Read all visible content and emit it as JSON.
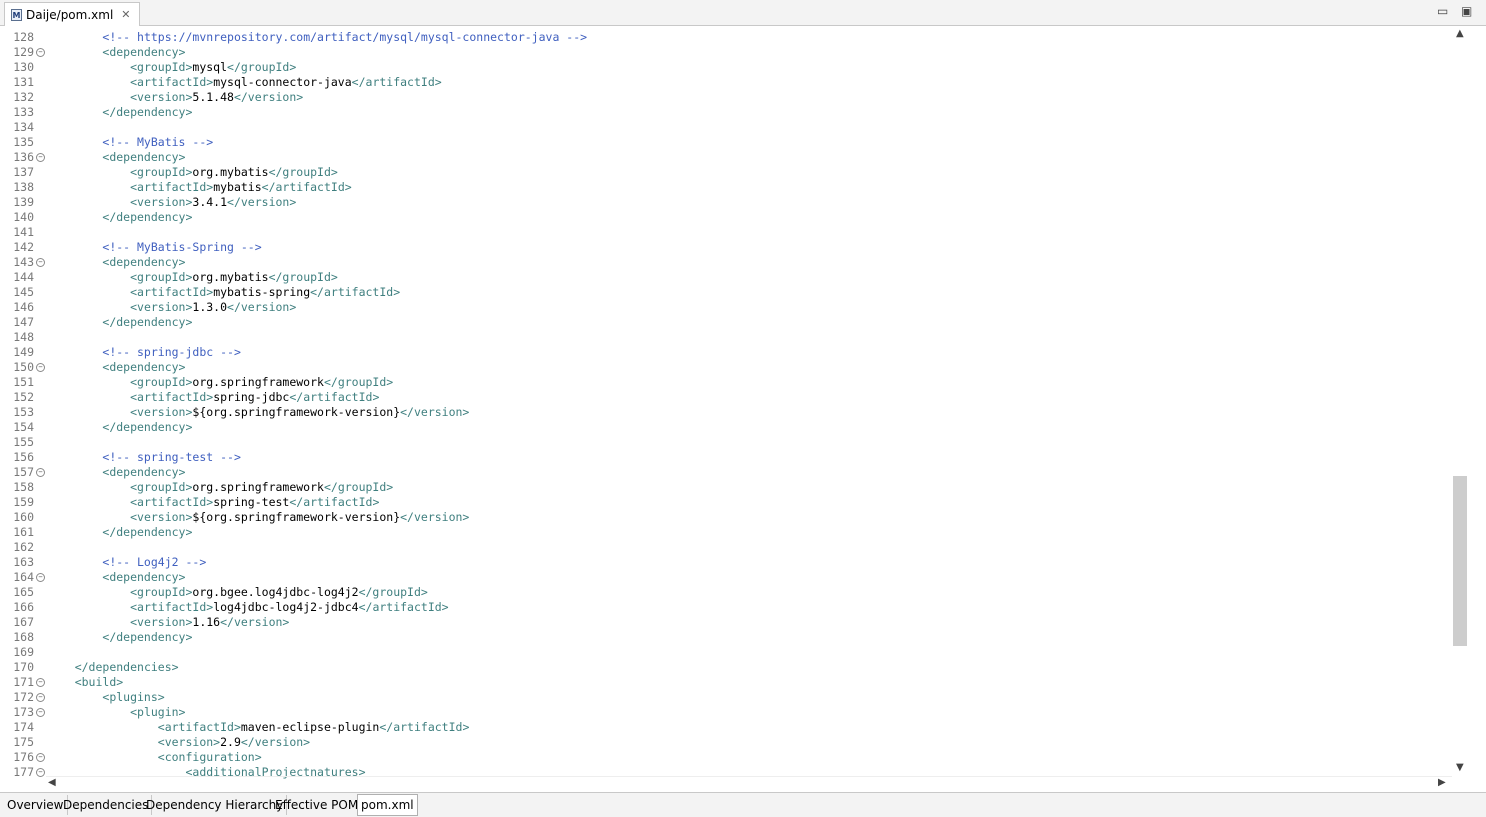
{
  "tab": {
    "title": "Daije/pom.xml",
    "icon": "maven-pom-icon"
  },
  "window_controls": {
    "minimize": "▭",
    "maximize": "▣"
  },
  "lines": [
    {
      "num": "128",
      "fold": false,
      "tokens": [
        [
          "    ",
          "txt"
        ],
        [
          "    ",
          "txt"
        ],
        [
          "<!-- https://mvnrepository.com/artifact/mysql/mysql-connector-java -->",
          "cmt"
        ]
      ]
    },
    {
      "num": "129",
      "fold": true,
      "tokens": [
        [
          "        ",
          "txt"
        ],
        [
          "<dependency>",
          "tag"
        ]
      ]
    },
    {
      "num": "130",
      "fold": false,
      "tokens": [
        [
          "            ",
          "txt"
        ],
        [
          "<groupId>",
          "tag"
        ],
        [
          "mysql",
          "txt"
        ],
        [
          "</groupId>",
          "tag"
        ]
      ]
    },
    {
      "num": "131",
      "fold": false,
      "tokens": [
        [
          "            ",
          "txt"
        ],
        [
          "<artifactId>",
          "tag"
        ],
        [
          "mysql-connector-java",
          "txt"
        ],
        [
          "</artifactId>",
          "tag"
        ]
      ]
    },
    {
      "num": "132",
      "fold": false,
      "tokens": [
        [
          "            ",
          "txt"
        ],
        [
          "<version>",
          "tag"
        ],
        [
          "5.1.48",
          "txt"
        ],
        [
          "</version>",
          "tag"
        ]
      ]
    },
    {
      "num": "133",
      "fold": false,
      "tokens": [
        [
          "        ",
          "txt"
        ],
        [
          "</dependency>",
          "tag"
        ]
      ]
    },
    {
      "num": "134",
      "fold": false,
      "tokens": []
    },
    {
      "num": "135",
      "fold": false,
      "tokens": [
        [
          "        ",
          "txt"
        ],
        [
          "<!-- MyBatis -->",
          "cmt"
        ]
      ]
    },
    {
      "num": "136",
      "fold": true,
      "tokens": [
        [
          "        ",
          "txt"
        ],
        [
          "<dependency>",
          "tag"
        ]
      ]
    },
    {
      "num": "137",
      "fold": false,
      "tokens": [
        [
          "            ",
          "txt"
        ],
        [
          "<groupId>",
          "tag"
        ],
        [
          "org.mybatis",
          "txt"
        ],
        [
          "</groupId>",
          "tag"
        ]
      ]
    },
    {
      "num": "138",
      "fold": false,
      "tokens": [
        [
          "            ",
          "txt"
        ],
        [
          "<artifactId>",
          "tag"
        ],
        [
          "mybatis",
          "txt"
        ],
        [
          "</artifactId>",
          "tag"
        ]
      ]
    },
    {
      "num": "139",
      "fold": false,
      "tokens": [
        [
          "            ",
          "txt"
        ],
        [
          "<version>",
          "tag"
        ],
        [
          "3.4.1",
          "txt"
        ],
        [
          "</version>",
          "tag"
        ]
      ]
    },
    {
      "num": "140",
      "fold": false,
      "tokens": [
        [
          "        ",
          "txt"
        ],
        [
          "</dependency>",
          "tag"
        ]
      ]
    },
    {
      "num": "141",
      "fold": false,
      "tokens": []
    },
    {
      "num": "142",
      "fold": false,
      "tokens": [
        [
          "        ",
          "txt"
        ],
        [
          "<!-- MyBatis-Spring -->",
          "cmt"
        ]
      ]
    },
    {
      "num": "143",
      "fold": true,
      "tokens": [
        [
          "        ",
          "txt"
        ],
        [
          "<dependency>",
          "tag"
        ]
      ]
    },
    {
      "num": "144",
      "fold": false,
      "tokens": [
        [
          "            ",
          "txt"
        ],
        [
          "<groupId>",
          "tag"
        ],
        [
          "org.mybatis",
          "txt"
        ],
        [
          "</groupId>",
          "tag"
        ]
      ]
    },
    {
      "num": "145",
      "fold": false,
      "tokens": [
        [
          "            ",
          "txt"
        ],
        [
          "<artifactId>",
          "tag"
        ],
        [
          "mybatis-spring",
          "txt"
        ],
        [
          "</artifactId>",
          "tag"
        ]
      ]
    },
    {
      "num": "146",
      "fold": false,
      "tokens": [
        [
          "            ",
          "txt"
        ],
        [
          "<version>",
          "tag"
        ],
        [
          "1.3.0",
          "txt"
        ],
        [
          "</version>",
          "tag"
        ]
      ]
    },
    {
      "num": "147",
      "fold": false,
      "tokens": [
        [
          "        ",
          "txt"
        ],
        [
          "</dependency>",
          "tag"
        ]
      ]
    },
    {
      "num": "148",
      "fold": false,
      "tokens": []
    },
    {
      "num": "149",
      "fold": false,
      "tokens": [
        [
          "        ",
          "txt"
        ],
        [
          "<!-- spring-jdbc -->",
          "cmt"
        ]
      ]
    },
    {
      "num": "150",
      "fold": true,
      "tokens": [
        [
          "        ",
          "txt"
        ],
        [
          "<dependency>",
          "tag"
        ]
      ]
    },
    {
      "num": "151",
      "fold": false,
      "tokens": [
        [
          "            ",
          "txt"
        ],
        [
          "<groupId>",
          "tag"
        ],
        [
          "org.springframework",
          "txt"
        ],
        [
          "</groupId>",
          "tag"
        ]
      ]
    },
    {
      "num": "152",
      "fold": false,
      "tokens": [
        [
          "            ",
          "txt"
        ],
        [
          "<artifactId>",
          "tag"
        ],
        [
          "spring-jdbc",
          "txt"
        ],
        [
          "</artifactId>",
          "tag"
        ]
      ]
    },
    {
      "num": "153",
      "fold": false,
      "tokens": [
        [
          "            ",
          "txt"
        ],
        [
          "<version>",
          "tag"
        ],
        [
          "${org.springframework-version}",
          "txt"
        ],
        [
          "</version>",
          "tag"
        ]
      ]
    },
    {
      "num": "154",
      "fold": false,
      "tokens": [
        [
          "        ",
          "txt"
        ],
        [
          "</dependency>",
          "tag"
        ]
      ]
    },
    {
      "num": "155",
      "fold": false,
      "tokens": []
    },
    {
      "num": "156",
      "fold": false,
      "tokens": [
        [
          "        ",
          "txt"
        ],
        [
          "<!-- spring-test -->",
          "cmt"
        ]
      ]
    },
    {
      "num": "157",
      "fold": true,
      "tokens": [
        [
          "        ",
          "txt"
        ],
        [
          "<dependency>",
          "tag"
        ]
      ]
    },
    {
      "num": "158",
      "fold": false,
      "tokens": [
        [
          "            ",
          "txt"
        ],
        [
          "<groupId>",
          "tag"
        ],
        [
          "org.springframework",
          "txt"
        ],
        [
          "</groupId>",
          "tag"
        ]
      ]
    },
    {
      "num": "159",
      "fold": false,
      "tokens": [
        [
          "            ",
          "txt"
        ],
        [
          "<artifactId>",
          "tag"
        ],
        [
          "spring-test",
          "txt"
        ],
        [
          "</artifactId>",
          "tag"
        ]
      ]
    },
    {
      "num": "160",
      "fold": false,
      "tokens": [
        [
          "            ",
          "txt"
        ],
        [
          "<version>",
          "tag"
        ],
        [
          "${org.springframework-version}",
          "txt"
        ],
        [
          "</version>",
          "tag"
        ]
      ]
    },
    {
      "num": "161",
      "fold": false,
      "tokens": [
        [
          "        ",
          "txt"
        ],
        [
          "</dependency>",
          "tag"
        ]
      ]
    },
    {
      "num": "162",
      "fold": false,
      "tokens": []
    },
    {
      "num": "163",
      "fold": false,
      "tokens": [
        [
          "        ",
          "txt"
        ],
        [
          "<!-- Log4j2 -->",
          "cmt"
        ]
      ]
    },
    {
      "num": "164",
      "fold": true,
      "tokens": [
        [
          "        ",
          "txt"
        ],
        [
          "<dependency>",
          "tag"
        ]
      ]
    },
    {
      "num": "165",
      "fold": false,
      "tokens": [
        [
          "            ",
          "txt"
        ],
        [
          "<groupId>",
          "tag"
        ],
        [
          "org.bgee.log4jdbc-log4j2",
          "txt"
        ],
        [
          "</groupId>",
          "tag"
        ]
      ]
    },
    {
      "num": "166",
      "fold": false,
      "tokens": [
        [
          "            ",
          "txt"
        ],
        [
          "<artifactId>",
          "tag"
        ],
        [
          "log4jdbc-log4j2-jdbc4",
          "txt"
        ],
        [
          "</artifactId>",
          "tag"
        ]
      ]
    },
    {
      "num": "167",
      "fold": false,
      "tokens": [
        [
          "            ",
          "txt"
        ],
        [
          "<version>",
          "tag"
        ],
        [
          "1.16",
          "txt"
        ],
        [
          "</version>",
          "tag"
        ]
      ]
    },
    {
      "num": "168",
      "fold": false,
      "tokens": [
        [
          "        ",
          "txt"
        ],
        [
          "</dependency>",
          "tag"
        ]
      ]
    },
    {
      "num": "169",
      "fold": false,
      "tokens": []
    },
    {
      "num": "170",
      "fold": false,
      "tokens": [
        [
          "    ",
          "txt"
        ],
        [
          "</dependencies>",
          "tag"
        ]
      ]
    },
    {
      "num": "171",
      "fold": true,
      "tokens": [
        [
          "    ",
          "txt"
        ],
        [
          "<build>",
          "tag"
        ]
      ]
    },
    {
      "num": "172",
      "fold": true,
      "tokens": [
        [
          "        ",
          "txt"
        ],
        [
          "<plugins>",
          "tag"
        ]
      ]
    },
    {
      "num": "173",
      "fold": true,
      "tokens": [
        [
          "            ",
          "txt"
        ],
        [
          "<plugin>",
          "tag"
        ]
      ]
    },
    {
      "num": "174",
      "fold": false,
      "tokens": [
        [
          "                ",
          "txt"
        ],
        [
          "<artifactId>",
          "tag"
        ],
        [
          "maven-eclipse-plugin",
          "txt"
        ],
        [
          "</artifactId>",
          "tag"
        ]
      ]
    },
    {
      "num": "175",
      "fold": false,
      "tokens": [
        [
          "                ",
          "txt"
        ],
        [
          "<version>",
          "tag"
        ],
        [
          "2.9",
          "txt"
        ],
        [
          "</version>",
          "tag"
        ]
      ]
    },
    {
      "num": "176",
      "fold": true,
      "tokens": [
        [
          "                ",
          "txt"
        ],
        [
          "<configuration>",
          "tag"
        ]
      ]
    },
    {
      "num": "177",
      "fold": true,
      "tokens": [
        [
          "                    ",
          "txt"
        ],
        [
          "<additionalProjectnatures>",
          "tag"
        ]
      ]
    }
  ],
  "bottom_tabs": [
    {
      "label": "Overview",
      "active": false
    },
    {
      "label": "Dependencies",
      "active": false
    },
    {
      "label": "Dependency Hierarchy",
      "active": false
    },
    {
      "label": "Effective POM",
      "active": false
    },
    {
      "label": "pom.xml",
      "active": true
    }
  ]
}
